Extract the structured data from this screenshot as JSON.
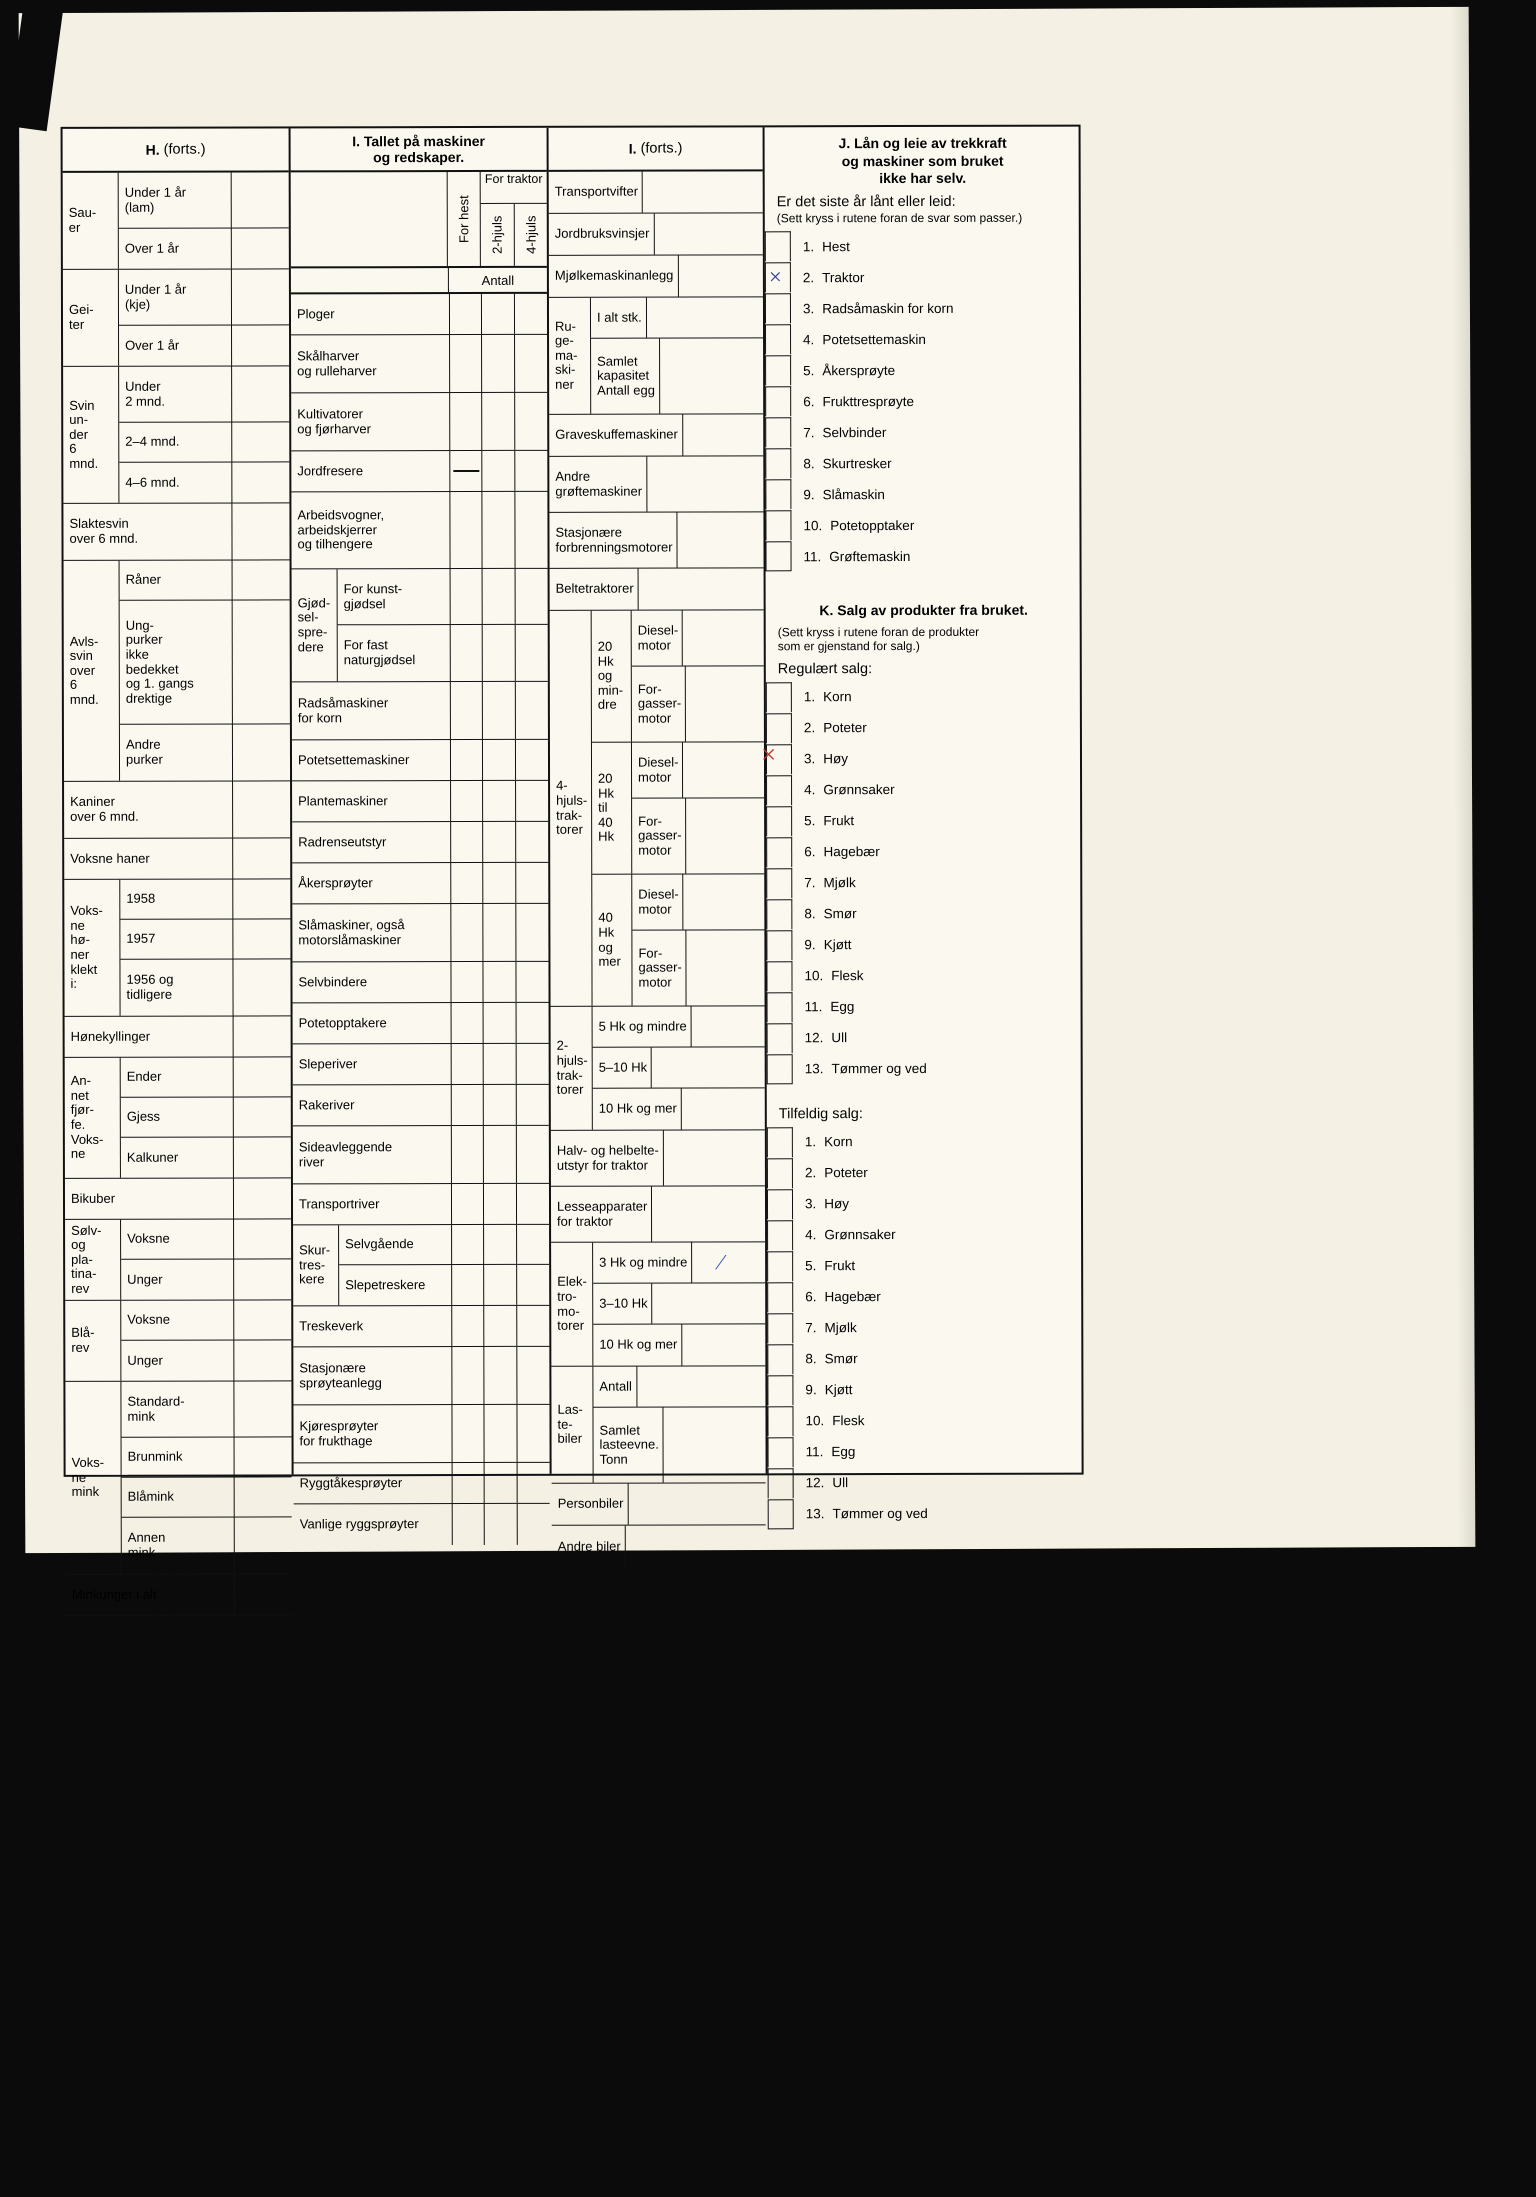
{
  "document": {
    "kind": "Norwegian agricultural census form, scanned page",
    "columns": {
      "livestock_header": "H.",
      "livestock_header_note": "(forts.)",
      "machines_header": "I. Tallet på maskiner",
      "machines_header_line2": "og redskaper.",
      "machines_cont_header": "I.",
      "machines_cont_note": "(forts.)"
    }
  },
  "livestock": {
    "groups": [
      {
        "group": "Sau-\ner",
        "rows": [
          "Under 1 år\n(lam)",
          "Over 1 år"
        ]
      },
      {
        "group": "Gei-\nter",
        "rows": [
          "Under 1 år\n(kje)",
          "Over 1 år"
        ]
      },
      {
        "group": "Svin\nun-\nder\n6\nmnd.",
        "rows": [
          "Under\n2 mnd.",
          "2–4 mnd.",
          "4–6 mnd."
        ]
      },
      {
        "group": "",
        "rows": [
          "Slaktesvin\nover 6 mnd."
        ]
      },
      {
        "group": "Avls-\nsvin\nover\n6\nmnd.",
        "rows": [
          "Råner",
          "Ung-\npurker\nikke\nbedekket\nog 1. gangs\ndrektige",
          "Andre\npurker"
        ]
      },
      {
        "group": "",
        "rows": [
          "Kaniner\nover 6 mnd."
        ]
      },
      {
        "group": "",
        "rows": [
          "Voksne haner"
        ]
      },
      {
        "group": "Voks-\nne\nhø-\nner\nklekt\ni:",
        "rows": [
          "1958",
          "1957",
          "1956 og\ntidligere"
        ]
      },
      {
        "group": "",
        "rows": [
          "Hønekyllinger"
        ]
      },
      {
        "group": "An-\nnet\nfjør-\nfe.\nVoks-\nne",
        "rows": [
          "Ender",
          "Gjess",
          "Kalkuner"
        ]
      },
      {
        "group": "",
        "rows": [
          "Bikuber"
        ]
      },
      {
        "group": "Sølv-\nog\npla-\ntina-\nrev",
        "rows": [
          "Voksne",
          "Unger"
        ]
      },
      {
        "group": "Blå-\nrev",
        "rows": [
          "Voksne",
          "Unger"
        ]
      },
      {
        "group": "Voks-\nne\nmink",
        "rows": [
          "Standard-\nmink",
          "Brunmink",
          "Blåmink",
          "Annen\nmink"
        ]
      },
      {
        "group": "",
        "rows": [
          "Minkunger i alt"
        ]
      }
    ]
  },
  "machines": {
    "col_headers": {
      "for_horse": "For hest",
      "for_tractor": "For traktor",
      "two_wheel": "2-hjuls",
      "four_wheel": "4-hjuls",
      "count": "Antall"
    },
    "rows": [
      {
        "label": "Ploger"
      },
      {
        "label": "Skålharver\nog rulleharver"
      },
      {
        "label": "Kultivatorer\nog fjørharver"
      },
      {
        "label": "Jordfresere",
        "mark": "dash"
      },
      {
        "label": "Arbeidsvogner,\narbeidskjerrer\nog tilhengere"
      },
      {
        "group": "Gjød-\nsel-\nspre-\ndere",
        "label": "For kunst-\ngjødsel"
      },
      {
        "group": "",
        "label": "For fast\nnaturgjødsel"
      },
      {
        "label": "Radsåmaskiner\nfor korn"
      },
      {
        "label": "Potetsettemaskiner"
      },
      {
        "label": "Plantemaskiner"
      },
      {
        "label": "Radrenseutstyr"
      },
      {
        "label": "Åkersprøyter"
      },
      {
        "label": "Slåmaskiner, også\nmotorslåmaskiner"
      },
      {
        "label": "Selvbindere"
      },
      {
        "label": "Potetopptakere"
      },
      {
        "label": "Sleperiver"
      },
      {
        "label": "Rakeriver"
      },
      {
        "label": "Sideavleggende\nriver"
      },
      {
        "label": "Transportriver"
      },
      {
        "group": "Skur-\ntres-\nkere",
        "label": "Selvgående"
      },
      {
        "group": "",
        "label": "Slepetreskere"
      },
      {
        "label": "Treskeverk"
      },
      {
        "label": "Stasjonære\nsprøyteanlegg"
      },
      {
        "label": "Kjøresprøyter\nfor frukthage"
      },
      {
        "label": "Ryggtåkesprøyter"
      },
      {
        "label": "Vanlige ryggsprøyter"
      }
    ]
  },
  "machines_cont": {
    "rows": [
      {
        "label": "Transportvifter"
      },
      {
        "label": "Jordbruksvinsjer"
      },
      {
        "label": "Mjølkemaskinanlegg"
      },
      {
        "group": "Ru-\nge-\nma-\nski-\nner",
        "label": "I alt stk."
      },
      {
        "group": "",
        "label": "Samlet\nkapasitet\nAntall egg"
      },
      {
        "label": "Graveskuffemaskiner"
      },
      {
        "label": "Andre\ngrøftemaskiner"
      },
      {
        "label": "Stasjonære\nforbrenningsmotorer"
      },
      {
        "label": "Beltetraktorer"
      },
      {
        "group": "4-\nhjuls-\ntrak-\ntorer",
        "sub": "20\nHk\nog\nmin-\ndre",
        "label": "Diesel-\nmotor"
      },
      {
        "group": "",
        "sub": "",
        "label": "For-\ngasser-\nmotor"
      },
      {
        "group": "",
        "sub": "20\nHk\ntil\n40\nHk",
        "label": "Diesel-\nmotor"
      },
      {
        "group": "",
        "sub": "",
        "label": "For-\ngasser-\nmotor"
      },
      {
        "group": "",
        "sub": "40\nHk\nog\nmer",
        "label": "Diesel-\nmotor"
      },
      {
        "group": "",
        "sub": "",
        "label": "For-\ngasser-\nmotor"
      },
      {
        "group": "2-\nhjuls-\ntrak-\ntorer",
        "label": "5 Hk og mindre"
      },
      {
        "group": "",
        "label": "5–10 Hk"
      },
      {
        "group": "",
        "label": "10 Hk og mer"
      },
      {
        "label": "Halv- og helbelte-\nutstyr for traktor"
      },
      {
        "label": "Lesseapparater\nfor traktor"
      },
      {
        "group": "Elek-\ntro-\nmo-\ntorer",
        "label": "3 Hk og mindre",
        "mark": "blue-slash"
      },
      {
        "group": "",
        "label": "3–10 Hk"
      },
      {
        "group": "",
        "label": "10 Hk og mer"
      },
      {
        "group": "Las-\nte-\nbiler",
        "label": "Antall"
      },
      {
        "group": "",
        "label": "Samlet\nlasteevne.\nTonn"
      },
      {
        "label": "Personbiler"
      },
      {
        "label": "Andre biler"
      }
    ]
  },
  "section_j": {
    "title_line1": "J. Lån og leie av trekkraft",
    "title_line2": "og maskiner som bruket",
    "title_line3": "ikke har selv.",
    "question": "Er det siste år lånt eller leid:",
    "note": "(Sett kryss i rutene foran de svar som passer.)",
    "items": [
      {
        "num": "1.",
        "label": "Hest",
        "checked": false
      },
      {
        "num": "2.",
        "label": "Traktor",
        "checked": true,
        "mark": "×",
        "mark_color": "#2f3f93"
      },
      {
        "num": "3.",
        "label": "Radsåmaskin for korn",
        "checked": false
      },
      {
        "num": "4.",
        "label": "Potetsettemaskin",
        "checked": false
      },
      {
        "num": "5.",
        "label": "Åkersprøyte",
        "checked": false
      },
      {
        "num": "6.",
        "label": "Frukttresprøyte",
        "checked": false
      },
      {
        "num": "7.",
        "label": "Selvbinder",
        "checked": false
      },
      {
        "num": "8.",
        "label": "Skurtresker",
        "checked": false
      },
      {
        "num": "9.",
        "label": "Slåmaskin",
        "checked": false
      },
      {
        "num": "10.",
        "label": "Potetopptaker",
        "checked": false
      },
      {
        "num": "11.",
        "label": "Grøftemaskin",
        "checked": false
      }
    ]
  },
  "section_k": {
    "title": "K. Salg av produkter fra bruket.",
    "note_line1": "(Sett kryss i rutene foran de produkter",
    "note_line2": "som er gjenstand for salg.)",
    "regular_heading": "Regulært salg:",
    "regular_items": [
      {
        "num": "1.",
        "label": "Korn",
        "checked": false
      },
      {
        "num": "2.",
        "label": "Poteter",
        "checked": false
      },
      {
        "num": "3.",
        "label": "Høy",
        "checked": true,
        "mark": "×",
        "mark_color": "#c0392b"
      },
      {
        "num": "4.",
        "label": "Grønnsaker",
        "checked": false
      },
      {
        "num": "5.",
        "label": "Frukt",
        "checked": false
      },
      {
        "num": "6.",
        "label": "Hagebær",
        "checked": false
      },
      {
        "num": "7.",
        "label": "Mjølk",
        "checked": false
      },
      {
        "num": "8.",
        "label": "Smør",
        "checked": false
      },
      {
        "num": "9.",
        "label": "Kjøtt",
        "checked": false
      },
      {
        "num": "10.",
        "label": "Flesk",
        "checked": false
      },
      {
        "num": "11.",
        "label": "Egg",
        "checked": false
      },
      {
        "num": "12.",
        "label": "Ull",
        "checked": false
      },
      {
        "num": "13.",
        "label": "Tømmer og ved",
        "checked": false
      }
    ],
    "occasional_heading": "Tilfeldig salg:",
    "occasional_items": [
      {
        "num": "1.",
        "label": "Korn",
        "checked": false
      },
      {
        "num": "2.",
        "label": "Poteter",
        "checked": false
      },
      {
        "num": "3.",
        "label": "Høy",
        "checked": false
      },
      {
        "num": "4.",
        "label": "Grønnsaker",
        "checked": false
      },
      {
        "num": "5.",
        "label": "Frukt",
        "checked": false
      },
      {
        "num": "6.",
        "label": "Hagebær",
        "checked": false
      },
      {
        "num": "7.",
        "label": "Mjølk",
        "checked": false
      },
      {
        "num": "8.",
        "label": "Smør",
        "checked": false
      },
      {
        "num": "9.",
        "label": "Kjøtt",
        "checked": false
      },
      {
        "num": "10.",
        "label": "Flesk",
        "checked": false
      },
      {
        "num": "11.",
        "label": "Egg",
        "checked": false
      },
      {
        "num": "12.",
        "label": "Ull",
        "checked": false
      },
      {
        "num": "13.",
        "label": "Tømmer og ved",
        "checked": false
      }
    ]
  },
  "colors": {
    "paper": "#f4f1e4",
    "ink": "#111111",
    "pen_blue": "#2f3f93",
    "pen_red": "#c0392b",
    "backdrop": "#0b0b0b"
  }
}
